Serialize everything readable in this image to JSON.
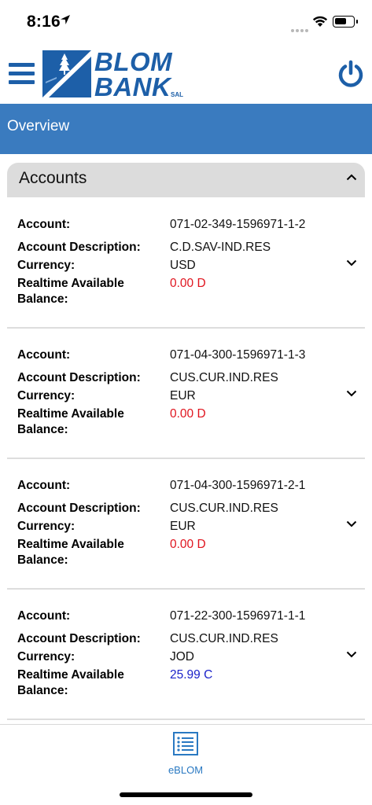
{
  "status_bar": {
    "time": "8:16"
  },
  "brand": {
    "name_line1": "BLOM",
    "name_line2": "BANK",
    "suffix": "SAL",
    "color": "#1d5fa8"
  },
  "header": {
    "menu_icon": "hamburger-menu-icon",
    "logout_icon": "power-icon"
  },
  "overview": {
    "title": "Overview",
    "bar_color": "#3a7bbf"
  },
  "accounts": {
    "section_title": "Accounts",
    "labels": {
      "account": "Account:",
      "description": "Account Description:",
      "currency": "Currency:",
      "balance_line1": "Realtime Available",
      "balance_line2": "Balance:"
    },
    "items": [
      {
        "account": "071-02-349-1596971-1-2",
        "description": "C.D.SAV-IND.RES",
        "currency": "USD",
        "balance": "0.00 D",
        "balance_color": "#e0141e"
      },
      {
        "account": "071-04-300-1596971-1-3",
        "description": "CUS.CUR.IND.RES",
        "currency": "EUR",
        "balance": "0.00 D",
        "balance_color": "#e0141e"
      },
      {
        "account": "071-04-300-1596971-2-1",
        "description": "CUS.CUR.IND.RES",
        "currency": "EUR",
        "balance": "0.00 D",
        "balance_color": "#e0141e"
      },
      {
        "account": "071-22-300-1596971-1-1",
        "description": "CUS.CUR.IND.RES",
        "currency": "JOD",
        "balance": "25.99 C",
        "balance_color": "#1b22c9"
      }
    ]
  },
  "bottom_nav": {
    "items": [
      {
        "label": "eBLOM",
        "icon": "list-icon"
      }
    ]
  }
}
